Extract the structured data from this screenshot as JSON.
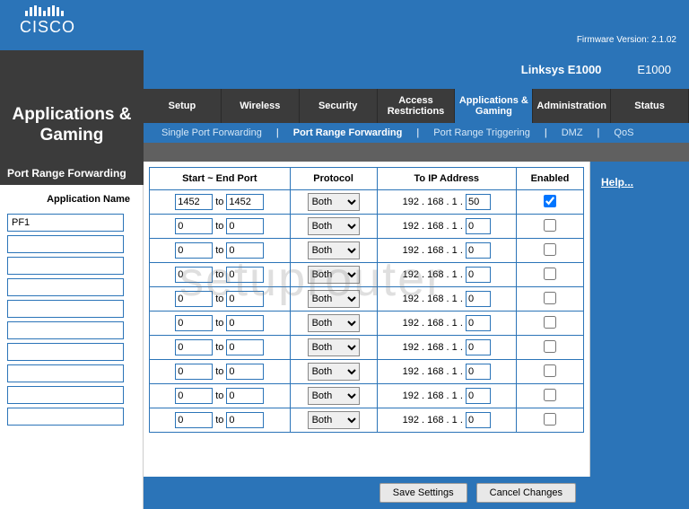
{
  "brand": "CISCO",
  "firmware_label": "Firmware Version: 2.1.02",
  "model_main": "Linksys E1000",
  "model_side": "E1000",
  "page_title": "Applications & Gaming",
  "nav": {
    "setup": "Setup",
    "wireless": "Wireless",
    "security": "Security",
    "access": "Access Restrictions",
    "apps": "Applications & Gaming",
    "admin": "Administration",
    "status": "Status"
  },
  "subnav": {
    "spf": "Single Port Forwarding",
    "prf": "Port Range Forwarding",
    "prt": "Port Range Triggering",
    "dmz": "DMZ",
    "qos": "QoS"
  },
  "section_label": "Port Range Forwarding",
  "left_header": "Application Name",
  "table_headers": {
    "port": "Start ~ End Port",
    "protocol": "Protocol",
    "ip": "To IP Address",
    "enabled": "Enabled"
  },
  "to_label": "to",
  "ip_prefix": "192 . 168 . 1 .",
  "protocol_option": "Both",
  "rows": [
    {
      "app": "PF1",
      "start": "1452",
      "end": "1452",
      "ip4": "50",
      "enabled": true
    },
    {
      "app": "",
      "start": "0",
      "end": "0",
      "ip4": "0",
      "enabled": false
    },
    {
      "app": "",
      "start": "0",
      "end": "0",
      "ip4": "0",
      "enabled": false
    },
    {
      "app": "",
      "start": "0",
      "end": "0",
      "ip4": "0",
      "enabled": false
    },
    {
      "app": "",
      "start": "0",
      "end": "0",
      "ip4": "0",
      "enabled": false
    },
    {
      "app": "",
      "start": "0",
      "end": "0",
      "ip4": "0",
      "enabled": false
    },
    {
      "app": "",
      "start": "0",
      "end": "0",
      "ip4": "0",
      "enabled": false
    },
    {
      "app": "",
      "start": "0",
      "end": "0",
      "ip4": "0",
      "enabled": false
    },
    {
      "app": "",
      "start": "0",
      "end": "0",
      "ip4": "0",
      "enabled": false
    },
    {
      "app": "",
      "start": "0",
      "end": "0",
      "ip4": "0",
      "enabled": false
    }
  ],
  "help_label": "Help...",
  "save_label": "Save Settings",
  "cancel_label": "Cancel Changes",
  "watermark": "setuprouter"
}
